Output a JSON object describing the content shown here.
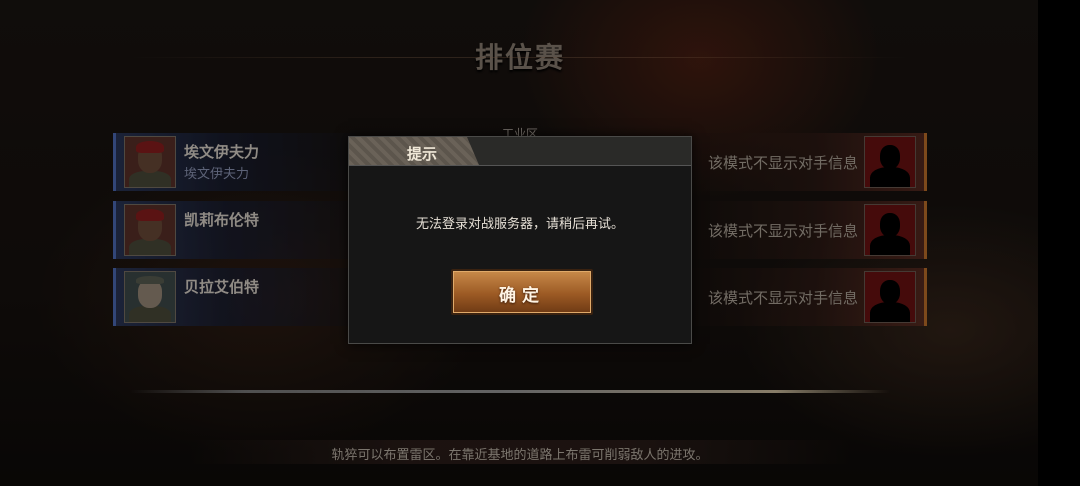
{
  "header": {
    "title": "排位赛"
  },
  "map": {
    "name": "工业区"
  },
  "team": [
    {
      "name": "埃文伊夫力",
      "subtitle": "埃文伊夫力"
    },
    {
      "name": "凯莉布伦特"
    },
    {
      "name": "贝拉艾伯特"
    }
  ],
  "opponents": [
    {
      "info": "该模式不显示对手信息"
    },
    {
      "info": "该模式不显示对手信息"
    },
    {
      "info": "该模式不显示对手信息"
    }
  ],
  "footer": {
    "tip": "轨猝可以布置雷区。在靠近基地的道路上布雷可削弱敌人的进攻。"
  },
  "dialog": {
    "title": "提示",
    "message": "无法登录对战服务器，请稍后再试。",
    "confirm_label": "确定"
  },
  "colors": {
    "team_accent": "#4e6cb8",
    "enemy_accent": "#c0702a",
    "button": "#9c5a24"
  }
}
